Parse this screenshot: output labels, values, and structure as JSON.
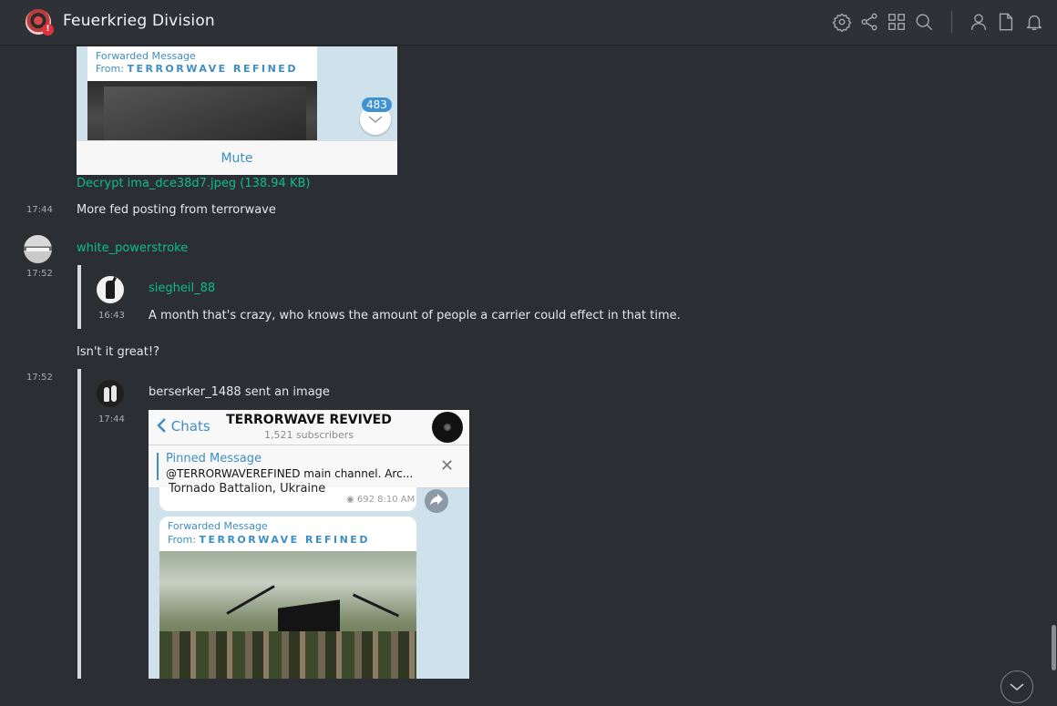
{
  "header": {
    "room_title": "Feuerkrieg Division",
    "room_badge": "!",
    "icons": [
      "settings-icon",
      "share-icon",
      "grid-icon",
      "search-icon",
      "user-icon",
      "files-icon",
      "bell-icon"
    ]
  },
  "timeline": {
    "image1": {
      "forwarded_label": "Forwarded Message",
      "from_label": "From:",
      "from_channel": "TERRORWAVE REFINED",
      "unread_count": "483",
      "mute_label": "Mute"
    },
    "file_link": "Decrypt ima_dce38d7.jpeg (138.94 KB)",
    "msg1": {
      "time": "17:44",
      "text": "More fed posting from terrorwave"
    },
    "user": {
      "name": "white_powerstroke",
      "time": "17:52"
    },
    "quote1": {
      "sender": "siegheil_88",
      "time": "16:43",
      "text": "A month that's crazy, who knows the amount of people a carrier could effect in that time."
    },
    "msg2": {
      "text": "Isn't it great!?"
    },
    "msg3_time": "17:52",
    "quote2": {
      "sender_text": "berserker_1488 sent an image",
      "time": "17:44"
    },
    "image2": {
      "back_label": "Chats",
      "channel_title": "TERRORWAVE REVIVED",
      "subscribers": "1,521 subscribers",
      "pinned_title": "Pinned Message",
      "pinned_text": "@TERRORWAVEREFINED main channel. Arc...",
      "prev_text": "Tornado Battalion, Ukraine",
      "prev_meta": "◉ 692 8:10 AM",
      "forwarded_label": "Forwarded Message",
      "from_label": "From:",
      "from_channel": "TERRORWAVE REFINED"
    }
  },
  "colors": {
    "accent": "#0dbd8b",
    "background": "#2b2e33",
    "telegram_blue": "#3c8ec4"
  }
}
